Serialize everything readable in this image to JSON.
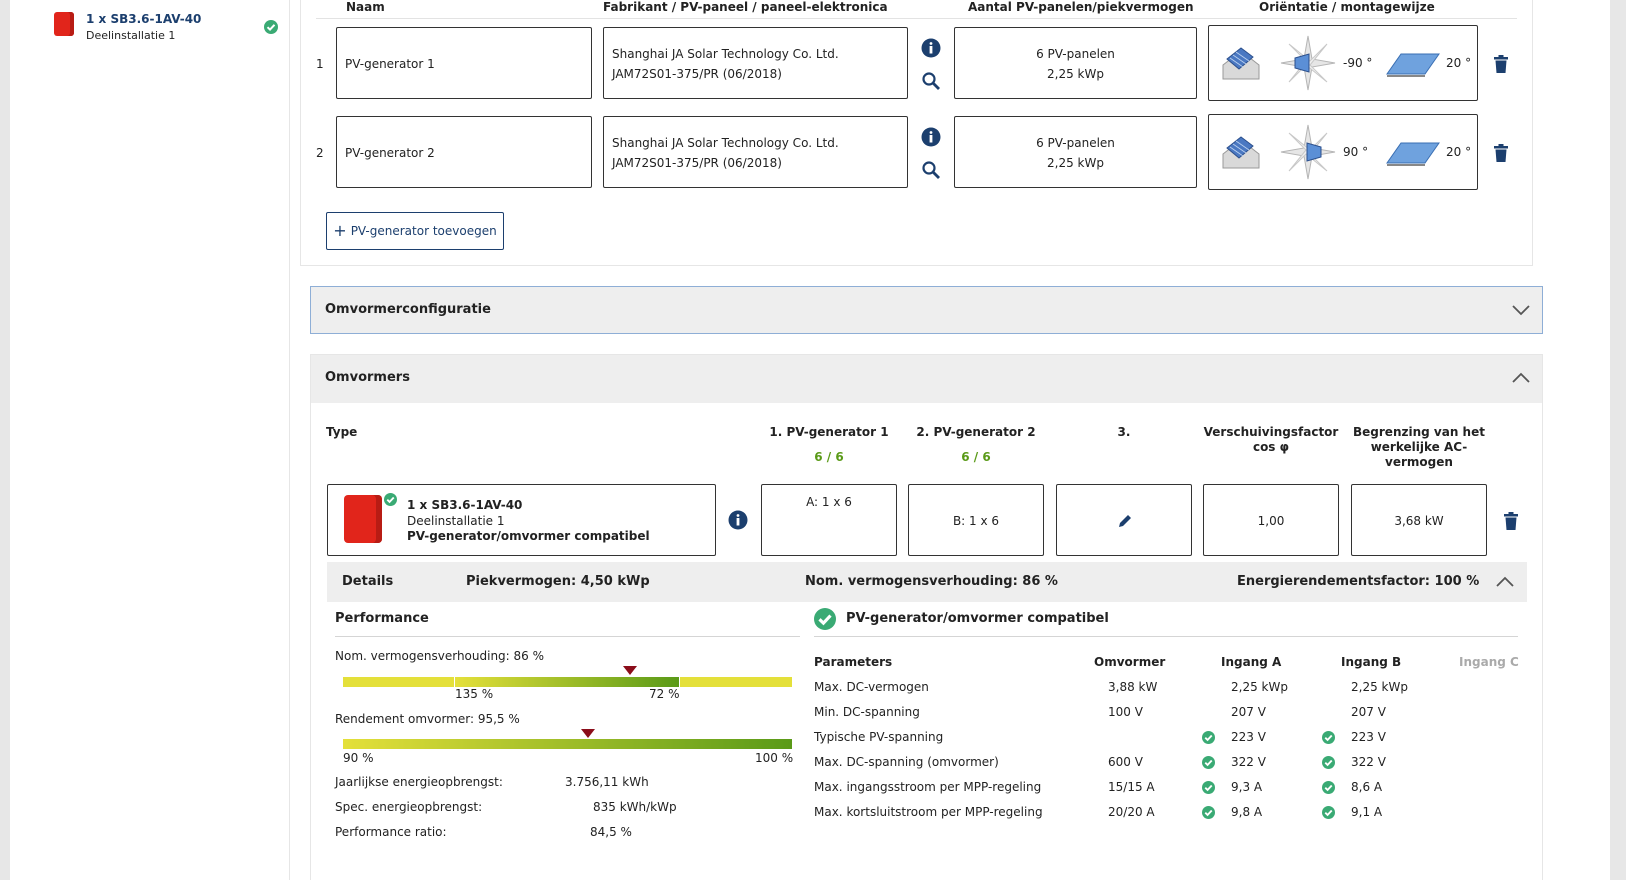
{
  "sidebar": {
    "inverter_title": "1 x SB3.6-1AV-40",
    "inverter_sub": "Deelinstallatie 1"
  },
  "generators": {
    "headers": {
      "name": "Naam",
      "manufacturer": "Fabrikant / PV-paneel / paneel-elektronica",
      "count": "Aantal PV-panelen/piekvermogen",
      "orientation": "Oriëntatie / montagewijze"
    },
    "rows": [
      {
        "num": "1",
        "name": "PV-generator 1",
        "mfr1": "Shanghai JA Solar Technology Co. Ltd.",
        "mfr2": "JAM72S01-375/PR (06/2018)",
        "panels": "6 PV-panelen",
        "kwp": "2,25 kWp",
        "azimuth": "-90 °",
        "tilt": "20 °"
      },
      {
        "num": "2",
        "name": "PV-generator 2",
        "mfr1": "Shanghai JA Solar Technology Co. Ltd.",
        "mfr2": "JAM72S01-375/PR (06/2018)",
        "panels": "6 PV-panelen",
        "kwp": "2,25 kWp",
        "azimuth": "90 °",
        "tilt": "20 °"
      }
    ],
    "add_button": "PV-generator toevoegen"
  },
  "omvormerconfiguratie": {
    "title": "Omvormerconfiguratie"
  },
  "omvormers": {
    "title": "Omvormers",
    "col_type": "Type",
    "col_pv1": "1. PV-generator 1",
    "col_pv2": "2. PV-generator 2",
    "col_pv3": "3.",
    "col_cos_1": "Verschuivingsfactor",
    "col_cos_2": "cos φ",
    "col_limit_1": "Begrenzing van het",
    "col_limit_2": "werkelijke AC-",
    "col_limit_3": "vermogen",
    "count_pv1": "6 / 6",
    "count_pv2": "6 / 6",
    "row": {
      "title": "1 x SB3.6-1AV-40",
      "sub": "Deelinstallatie 1",
      "compat": "PV-generator/omvormer compatibel",
      "pv1": "A: 1 x 6",
      "pv2": "B: 1 x 6",
      "cos": "1,00",
      "limit": "3,68 kW"
    },
    "details": {
      "label": "Details",
      "peak": "Piekvermogen: 4,50 kWp",
      "ratio": "Nom. vermogensverhouding: 86 %",
      "energy_factor": "Energierendementsfactor: 100 %"
    },
    "performance": {
      "title": "Performance",
      "ratio_label": "Nom. vermogensverhouding: 86 %",
      "ratio_scale_left": "135 %",
      "ratio_scale_right": "72 %",
      "ratio_value": 86,
      "eff_label": "Rendement omvormer: 95,5 %",
      "eff_scale_left": "90 %",
      "eff_scale_right": "100 %",
      "eff_value": 95.5,
      "yield_label": "Jaarlijkse energieopbrengst:",
      "yield_value": "3.756,11 kWh",
      "spec_label": "Spec. energieopbrengst:",
      "spec_value": "835 kWh/kWp",
      "pr_label": "Performance ratio:",
      "pr_value": "84,5 %"
    },
    "compat_panel": {
      "title": "PV-generator/omvormer compatibel",
      "headers": [
        "Parameters",
        "Omvormer",
        "Ingang A",
        "Ingang B",
        "Ingang C"
      ],
      "rows": [
        {
          "p": "Max. DC-vermogen",
          "o": "3,88 kW",
          "a": "2,25 kWp",
          "b": "2,25 kWp",
          "check": false
        },
        {
          "p": "Min. DC-spanning",
          "o": "100 V",
          "a": "207 V",
          "b": "207 V",
          "check": false
        },
        {
          "p": "Typische PV-spanning",
          "o": "",
          "a": "223 V",
          "b": "223 V",
          "check": true
        },
        {
          "p": "Max. DC-spanning (omvormer)",
          "o": "600 V",
          "a": "322 V",
          "b": "322 V",
          "check": true
        },
        {
          "p": "Max. ingangsstroom per MPP-regeling",
          "o": "15/15 A",
          "a": "9,3 A",
          "b": "8,6 A",
          "check": true
        },
        {
          "p": "Max. kortsluitstroom per MPP-regeling",
          "o": "20/20 A",
          "a": "9,8 A",
          "b": "9,1 A",
          "check": true
        }
      ]
    }
  },
  "colors": {
    "accent": "#1c3f6e",
    "ok_green": "#3aaa74",
    "bar_green": "#5a9a18",
    "bar_yellow": "#e4e03a",
    "marker": "#8b0d1a"
  }
}
